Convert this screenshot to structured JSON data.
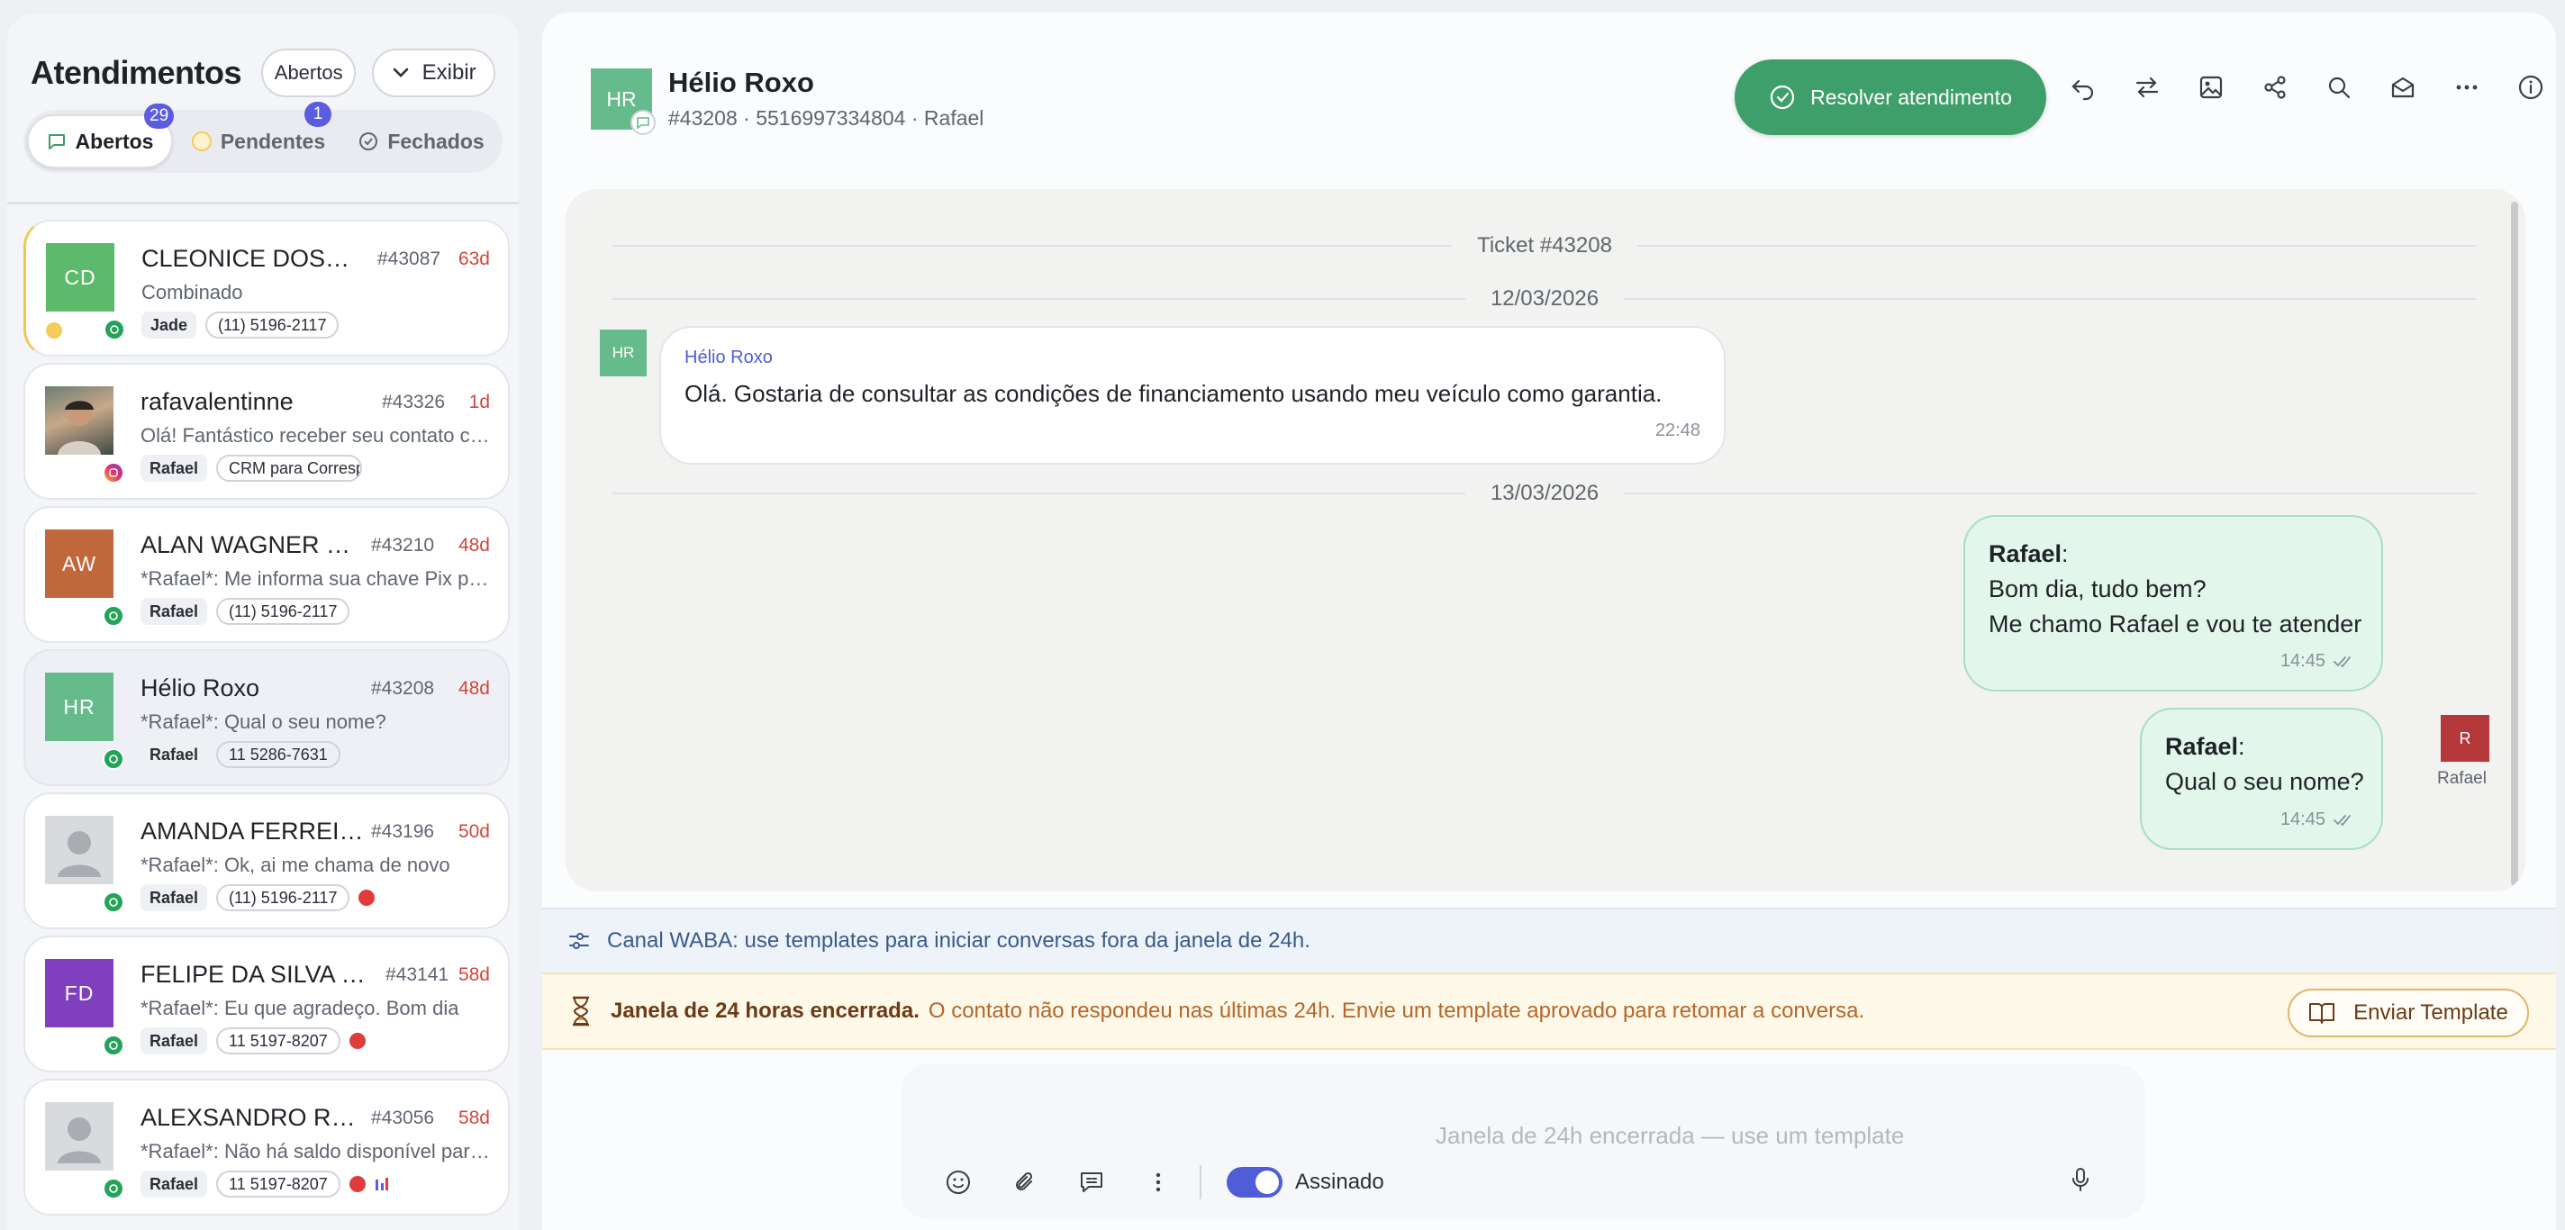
{
  "sidebar": {
    "title": "Atendimentos",
    "filter_label": "Abertos",
    "view_label": "Exibir",
    "tabs": [
      {
        "label": "Abertos",
        "badge": "29"
      },
      {
        "label": "Pendentes",
        "badge": "1"
      },
      {
        "label": "Fechados",
        "badge": ""
      }
    ],
    "tickets": [
      {
        "initials": "CD",
        "avatar_color": "#5dba6c",
        "name": "CLEONICE DOS SANTOS",
        "id": "#43087",
        "age": "63d",
        "preview": "Combinado",
        "user": "Jade",
        "phone": "(11) 5196-2117",
        "channel": "whatsapp",
        "flag": true,
        "red": false
      },
      {
        "initials": "",
        "avatar_color": "#8a9a8f",
        "name": "rafavalentinne",
        "id": "#43326",
        "age": "1d",
        "preview": "Olá! Fantástico receber seu contato com a gente",
        "user": "Rafael",
        "phone": "CRM para Correspondentes",
        "channel": "instagram",
        "flag": false,
        "red": false
      },
      {
        "initials": "AW",
        "avatar_color": "#c0683c",
        "name": "ALAN WAGNER DA SILVA",
        "id": "#43210",
        "age": "48d",
        "preview": "*Rafael*: Me informa sua chave Pix para o pagamento",
        "user": "Rafael",
        "phone": "(11) 5196-2117",
        "channel": "whatsapp",
        "flag": false,
        "red": false
      },
      {
        "initials": "HR",
        "avatar_color": "#66bb8c",
        "name": "Hélio Roxo",
        "id": "#43208",
        "age": "48d",
        "preview": "*Rafael*: Qual o seu nome?",
        "user": "Rafael",
        "phone": "11 5286-7631",
        "channel": "whatsapp",
        "flag": false,
        "red": false
      },
      {
        "initials": "",
        "avatar_color": "#d9dadd",
        "name": "AMANDA FERREIRA SOUZA",
        "id": "#43196",
        "age": "50d",
        "preview": "*Rafael*: Ok, ai me chama de novo",
        "user": "Rafael",
        "phone": "(11) 5196-2117",
        "channel": "whatsapp",
        "flag": false,
        "red": true
      },
      {
        "initials": "FD",
        "avatar_color": "#7f3fbf",
        "name": "FELIPE DA SILVA SANTOS",
        "id": "#43141",
        "age": "58d",
        "preview": "*Rafael*: Eu que agradeço. Bom dia",
        "user": "Rafael",
        "phone": "11 5197-8207",
        "channel": "whatsapp",
        "flag": false,
        "red": true
      },
      {
        "initials": "",
        "avatar_color": "#d9dadd",
        "name": "ALEXSANDRO RUBENS",
        "id": "#43056",
        "age": "58d",
        "preview": "*Rafael*: Não há saldo disponível para antecipação",
        "user": "Rafael",
        "phone": "11 5197-8207",
        "channel": "whatsapp",
        "flag": false,
        "red": true
      }
    ]
  },
  "conversation": {
    "initials": "HR",
    "name": "Hélio Roxo",
    "subtitle": "#43208 · 5516997334804 · Rafael",
    "resolve_label": "Resolver atendimento",
    "ticket_label": "Ticket #43208",
    "date1": "12/03/2026",
    "date2": "13/03/2026",
    "incoming": {
      "sender": "Hélio Roxo",
      "text": "Olá. Gostaria de consultar as condições de financiamento usando meu veículo como garantia.",
      "time": "22:48"
    },
    "outgoing": [
      {
        "author": "Rafael",
        "lines": [
          "Bom dia, tudo bem?",
          "Me chamo Rafael e vou te atender"
        ],
        "time": "14:45"
      },
      {
        "author": "Rafael",
        "lines": [
          "Qual o seu nome?"
        ],
        "time": "14:45"
      }
    ],
    "agent_initial": "R",
    "agent_name": "Rafael"
  },
  "banners": {
    "waba": "Canal WABA: use templates para iniciar conversas fora da janela de 24h.",
    "window_title": "Janela de 24 horas encerrada.",
    "window_text": "O contato não respondeu nas últimas 24h. Envie um template aprovado para retomar a conversa.",
    "template_button": "Enviar Template"
  },
  "composer": {
    "placeholder": "Janela de 24h encerrada — use um template",
    "signed_label": "Assinado"
  }
}
